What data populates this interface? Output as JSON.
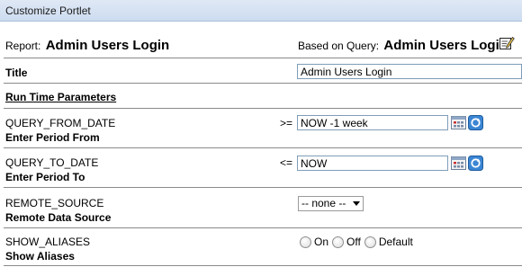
{
  "titlebar": {
    "title": "Customize Portlet"
  },
  "report": {
    "label": "Report:",
    "name": "Admin Users Login"
  },
  "based_on": {
    "label": "Based on Query:",
    "name": "Admin Users Login"
  },
  "title_field": {
    "label": "Title",
    "value": "Admin Users Login"
  },
  "section": {
    "label": "Run Time Parameters"
  },
  "params": [
    {
      "name": "QUERY_FROM_DATE",
      "description": "Enter Period From",
      "operator": ">=",
      "value": "NOW -1 week"
    },
    {
      "name": "QUERY_TO_DATE",
      "description": "Enter Period To",
      "operator": "<=",
      "value": "NOW"
    }
  ],
  "remote_source": {
    "name": "REMOTE_SOURCE",
    "description": "Remote Data Source",
    "selected": "-- none --"
  },
  "show_aliases": {
    "name": "SHOW_ALIASES",
    "description": "Show Aliases",
    "options": [
      "On",
      "Off",
      "Default"
    ]
  },
  "icons": {
    "edit": "edit-pencil-icon",
    "calendar": "calendar-icon",
    "go": "refresh-arrow-icon"
  },
  "colors": {
    "titlebar_bg": "#cddcf0",
    "input_border": "#7f9db9",
    "go_icon": "#2f7fd0"
  }
}
